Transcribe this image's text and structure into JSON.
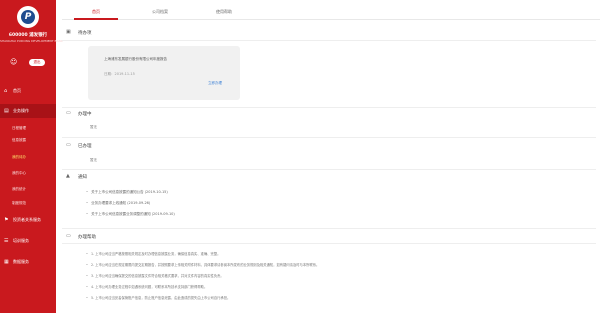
{
  "sidebar": {
    "company_name": "600000 浦发银行",
    "company_sub": "SHANGHAI PUDONG DEVELOPMENT BANK",
    "logout_label": "退出",
    "nav": [
      {
        "label": "首页"
      },
      {
        "label": "业务操作"
      },
      {
        "label": "投资者关系服务"
      },
      {
        "label": "培训服务"
      },
      {
        "label": "数据服务"
      }
    ],
    "sub_items": [
      {
        "label": "日程管理"
      },
      {
        "label": "信息披露"
      },
      {
        "label": "我的待办"
      },
      {
        "label": "我的中心"
      },
      {
        "label": "我的统计"
      },
      {
        "label": "制度规范"
      }
    ]
  },
  "tabs": [
    {
      "label": "首页"
    },
    {
      "label": "公司档案"
    },
    {
      "label": "使用帮助"
    }
  ],
  "sections": {
    "todo": {
      "title": "待办项"
    },
    "in_progress": {
      "title": "办理中",
      "empty": "暂无"
    },
    "done": {
      "title": "已办理",
      "empty": "暂无"
    },
    "notice": {
      "title": "通知"
    },
    "help": {
      "title": "办理帮助"
    }
  },
  "todo_card": {
    "title": "上海浦东发展银行股份有限公司年度报告",
    "date": "日期：2019-11-15",
    "link": "立即办理"
  },
  "notices": [
    {
      "text": "关于上市公司信息披露的通知公告 (2019-10-15)"
    },
    {
      "text": "业务办理要求上线通知 (2019-09-26)"
    },
    {
      "text": "关于上市公司信息披露业务调整的通知 (2019-09-10)"
    }
  ],
  "help_items": [
    {
      "text": "1. 上市公司应当严格按照相关规定及时办理信息披露业务，确保信息真实、准确、完整。"
    },
    {
      "text": "2. 上市公司应当在规定期限内提交定期报告，并按照要求上传相关附件材料，具体要求请参阅本所发布的业务规则及相关通知，如有疑问请及时与本所联系。"
    },
    {
      "text": "3. 上市公司应当确保提交的信息披露文件符合相关格式要求，并对文件内容的真实性负责。"
    },
    {
      "text": "4. 上市公司办理业务过程中如遇系统问题，可联系本所技术支持部门获得帮助。"
    },
    {
      "text": "5. 上市公司应当妥善保管账户信息，防止账户信息泄露，由此造成的损失由上市公司自行承担。"
    }
  ]
}
